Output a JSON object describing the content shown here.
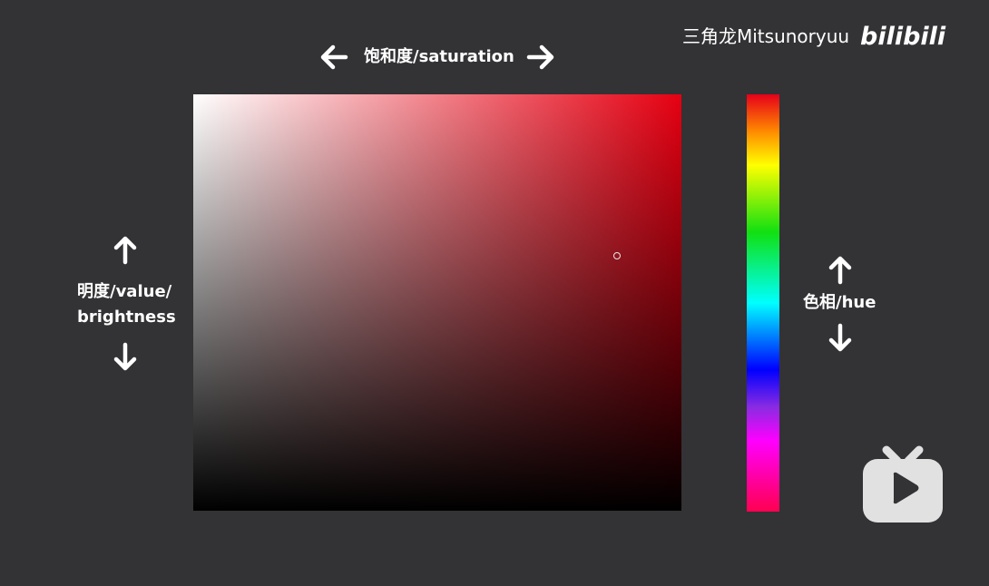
{
  "watermark": {
    "author": "三角龙Mitsunoryuu",
    "site_logo": "bilibili"
  },
  "labels": {
    "saturation": "饱和度/saturation",
    "value_line1": "明度/value/",
    "value_line2": "brightness",
    "hue": "色相/hue"
  },
  "colors": {
    "background": "#333235",
    "base_hue": "#e60012",
    "text": "#ffffff"
  },
  "icons": {
    "saturation_left": "arrow-left-icon",
    "saturation_right": "arrow-right-icon",
    "value_up": "arrow-up-icon",
    "value_down": "arrow-down-icon",
    "hue_up": "arrow-up-icon",
    "hue_down": "arrow-down-icon",
    "tv": "bilibili-tv-icon"
  },
  "picker": {
    "hue_stops": [
      "red",
      "orange",
      "yellow",
      "green",
      "cyan",
      "blue",
      "purple",
      "magenta",
      "red"
    ]
  }
}
